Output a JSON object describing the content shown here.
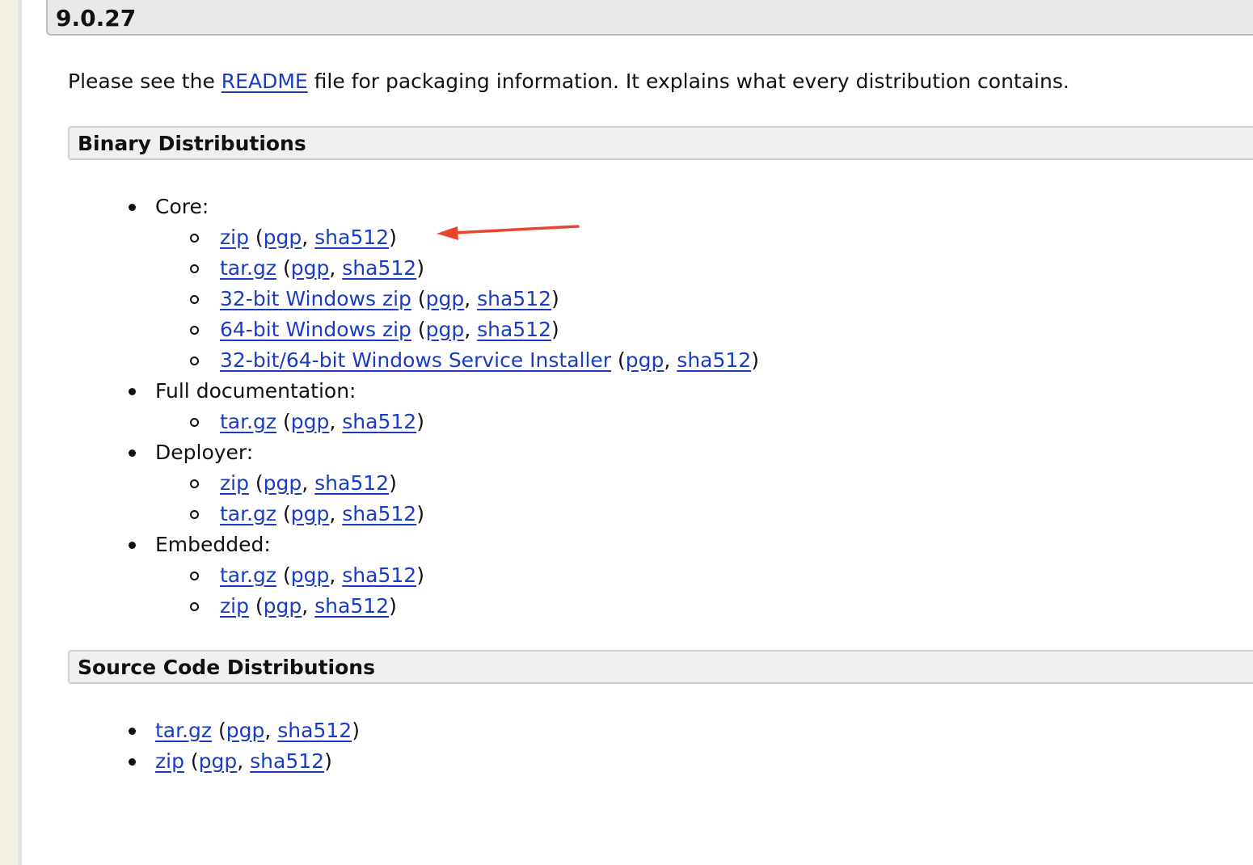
{
  "version_title": "9.0.27",
  "intro": {
    "before": "Please see the ",
    "link": "README",
    "after": " file for packaging information. It explains what every distribution contains."
  },
  "binary": {
    "heading": "Binary Distributions",
    "groups": [
      {
        "label": "Core:",
        "items": [
          {
            "name": "zip",
            "sig1": "pgp",
            "sig2": "sha512"
          },
          {
            "name": "tar.gz",
            "sig1": "pgp",
            "sig2": "sha512"
          },
          {
            "name": "32-bit Windows zip",
            "sig1": "pgp",
            "sig2": "sha512"
          },
          {
            "name": "64-bit Windows zip",
            "sig1": "pgp",
            "sig2": "sha512"
          },
          {
            "name": "32-bit/64-bit Windows Service Installer",
            "sig1": "pgp",
            "sig2": "sha512"
          }
        ]
      },
      {
        "label": "Full documentation:",
        "items": [
          {
            "name": "tar.gz",
            "sig1": "pgp",
            "sig2": "sha512"
          }
        ]
      },
      {
        "label": "Deployer:",
        "items": [
          {
            "name": "zip",
            "sig1": "pgp",
            "sig2": "sha512"
          },
          {
            "name": "tar.gz",
            "sig1": "pgp",
            "sig2": "sha512"
          }
        ]
      },
      {
        "label": "Embedded:",
        "items": [
          {
            "name": "tar.gz",
            "sig1": "pgp",
            "sig2": "sha512"
          },
          {
            "name": "zip",
            "sig1": "pgp",
            "sig2": "sha512"
          }
        ]
      }
    ]
  },
  "source": {
    "heading": "Source Code Distributions",
    "items": [
      {
        "name": "tar.gz",
        "sig1": "pgp",
        "sig2": "sha512"
      },
      {
        "name": "zip",
        "sig1": "pgp",
        "sig2": "sha512"
      }
    ]
  },
  "punct": {
    "open": " (",
    "comma": ", ",
    "close": ")"
  },
  "colors": {
    "link": "#1a3dbf",
    "annotation_arrow": "#e8452c"
  }
}
